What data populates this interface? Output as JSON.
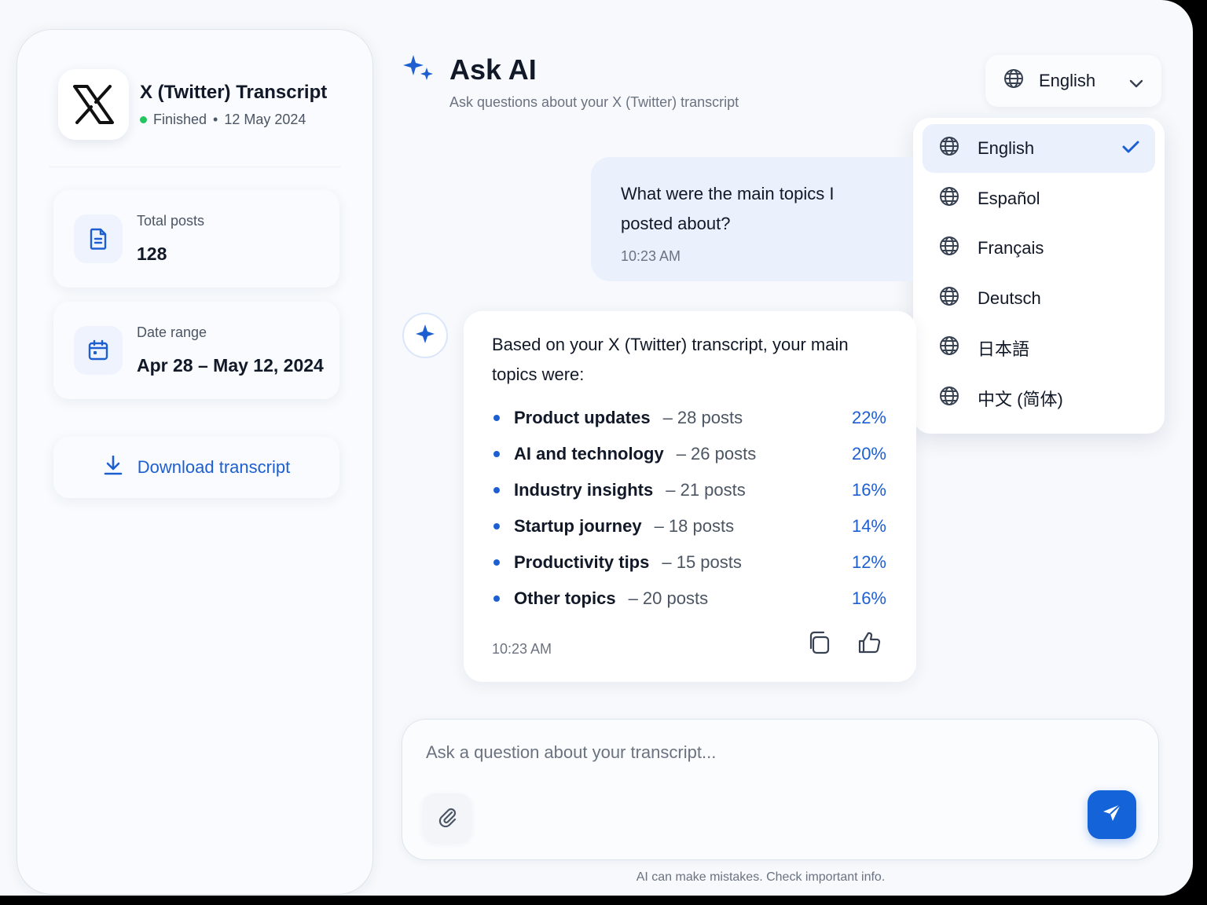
{
  "colors": {
    "accent": "#1d5fd1",
    "send_button": "#1463d8",
    "status_finished": "#22c55e",
    "user_bubble": "#eaf1fd"
  },
  "sidebar": {
    "file_title": "X (Twitter) Transcript",
    "status": "Finished",
    "separator": "•",
    "date": "12 May 2024",
    "stats": [
      {
        "icon": "document-icon",
        "label": "Total posts",
        "value": "128"
      },
      {
        "icon": "calendar-icon",
        "label": "Date range",
        "value": "Apr 28 – May 12, 2024"
      }
    ],
    "download_label": "Download transcript"
  },
  "header": {
    "title": "Ask AI",
    "subtitle": "Ask questions about your X (Twitter) transcript"
  },
  "language": {
    "selected": "English",
    "options": [
      {
        "label": "English",
        "selected": true
      },
      {
        "label": "Español",
        "selected": false
      },
      {
        "label": "Français",
        "selected": false
      },
      {
        "label": "Deutsch",
        "selected": false
      },
      {
        "label": "日本語",
        "selected": false
      },
      {
        "label": "中文 (简体)",
        "selected": false
      }
    ]
  },
  "messages": {
    "user": {
      "text": "What were the main topics I posted about?",
      "time": "10:23 AM"
    },
    "ai": {
      "intro": "Based on your X (Twitter) transcript, your main topics were:",
      "topics": [
        {
          "name": "Product updates",
          "count": "– 28 posts",
          "pct": "22%"
        },
        {
          "name": "AI and technology",
          "count": "– 26 posts",
          "pct": "20%"
        },
        {
          "name": "Industry insights",
          "count": "– 21 posts",
          "pct": "16%"
        },
        {
          "name": "Startup journey",
          "count": "– 18 posts",
          "pct": "14%"
        },
        {
          "name": "Productivity tips",
          "count": "– 15 posts",
          "pct": "12%"
        },
        {
          "name": "Other topics",
          "count": "– 20 posts",
          "pct": "16%"
        }
      ],
      "time": "10:23 AM"
    }
  },
  "composer": {
    "placeholder": "Ask a question about your transcript...",
    "value": ""
  },
  "disclaimer": "AI can make mistakes. Check important info."
}
